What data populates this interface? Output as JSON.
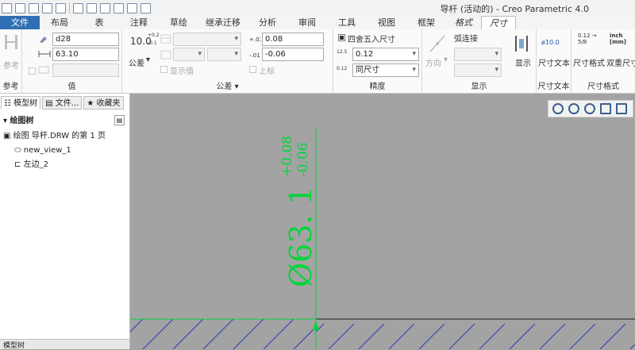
{
  "app": {
    "title": "导杆 (活动的) - Creo Parametric 4.0"
  },
  "tabs": [
    "文件",
    "布局",
    "表",
    "注释",
    "草绘",
    "继承迁移",
    "分析",
    "审阅",
    "工具",
    "视图",
    "框架",
    "格式",
    "尺寸"
  ],
  "ribbon": {
    "reference": {
      "button_label": "参考",
      "group_label": "参考"
    },
    "value": {
      "name_value": "d28",
      "nominal_value": "63.10",
      "group_label": "值"
    },
    "tolerance": {
      "tolerance_label": "公差",
      "tolerance_icon_text": "10.0",
      "tolerance_upper_small": "+0.2",
      "tolerance_lower_small": "-0.1",
      "upper_value": "0.08",
      "lower_value": "-0.06",
      "show_value_label": "显示值",
      "superscript_label": "上标",
      "group_label": "公差"
    },
    "precision": {
      "round_label": "四舍五入尺寸",
      "decimals_value": "0.12",
      "dual_value": "同尺寸",
      "icon_top": "12.5",
      "icon_bottom": "0.12",
      "group_label": "精度"
    },
    "display": {
      "arc_label": "弧连接",
      "direction_label": "方向",
      "show_label": "显示",
      "group_label": "显示"
    },
    "dim_text": {
      "button_label": "尺寸文本",
      "icon_text": "ø10.0",
      "group_label": "尺寸文本"
    },
    "dim_format": {
      "format_label": "尺寸格式",
      "dual_label": "双重尺寸",
      "icon_fraction": "0.12 → 5/8",
      "icon_units": "inch [mm]",
      "group_label": "尺寸格式"
    }
  },
  "side_panel": {
    "tabs": [
      "模型树",
      "文件...",
      "收藏夹"
    ],
    "tree_header": "绘图树",
    "items": [
      "绘图 导杆.DRW 的第 1 页",
      "new_view_1",
      "左边_2"
    ],
    "bottom_tab": "模型树"
  },
  "canvas": {
    "dimension_main": "Ø63. 1",
    "tol_upper": "+0.08",
    "tol_lower": "-0.06",
    "line_color": "#00d63a",
    "hatch_color": "#2a3cb8"
  }
}
